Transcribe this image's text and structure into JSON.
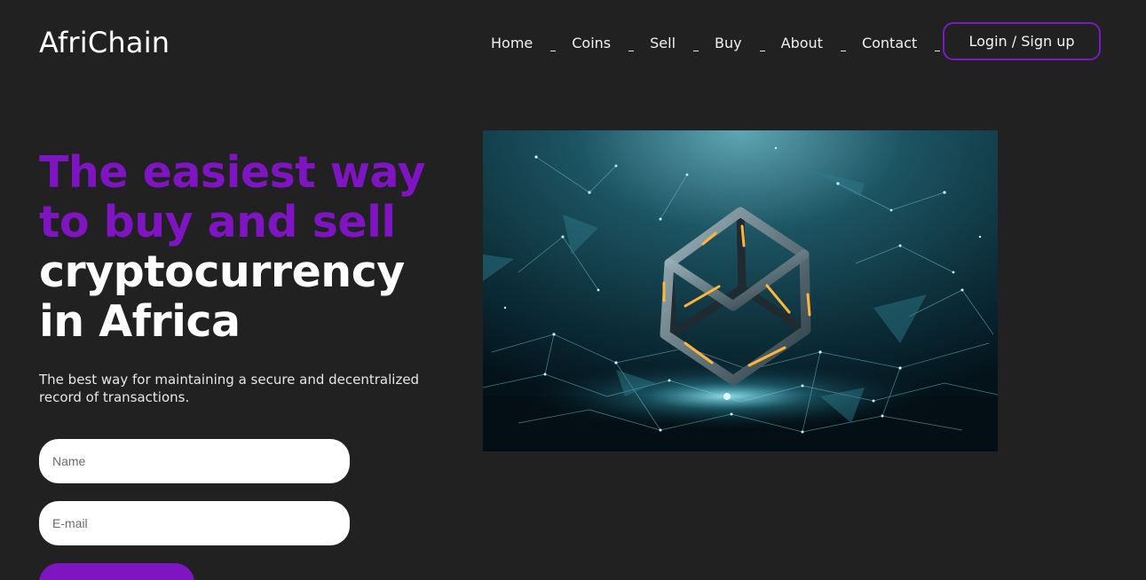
{
  "header": {
    "logo": "AfriChain",
    "nav": [
      {
        "label": "Home"
      },
      {
        "label": "Coins"
      },
      {
        "label": "Sell"
      },
      {
        "label": "Buy"
      },
      {
        "label": "About"
      },
      {
        "label": "Contact"
      }
    ],
    "login_label": "Login / Sign up"
  },
  "hero": {
    "headline_purple_1": "The easiest way",
    "headline_purple_2": "to buy and sell",
    "headline_white_1": "cryptocurrency",
    "headline_white_2": "in Africa",
    "subtext": "The best way for maintaining a secure and decentralized record of transactions."
  },
  "form": {
    "name_placeholder": "Name",
    "email_placeholder": "E-mail"
  },
  "image": {
    "icon": "blockchain-cube-illustration"
  },
  "colors": {
    "background": "#212121",
    "accent": "#7e14c2",
    "button_border": "#7b19c4"
  }
}
